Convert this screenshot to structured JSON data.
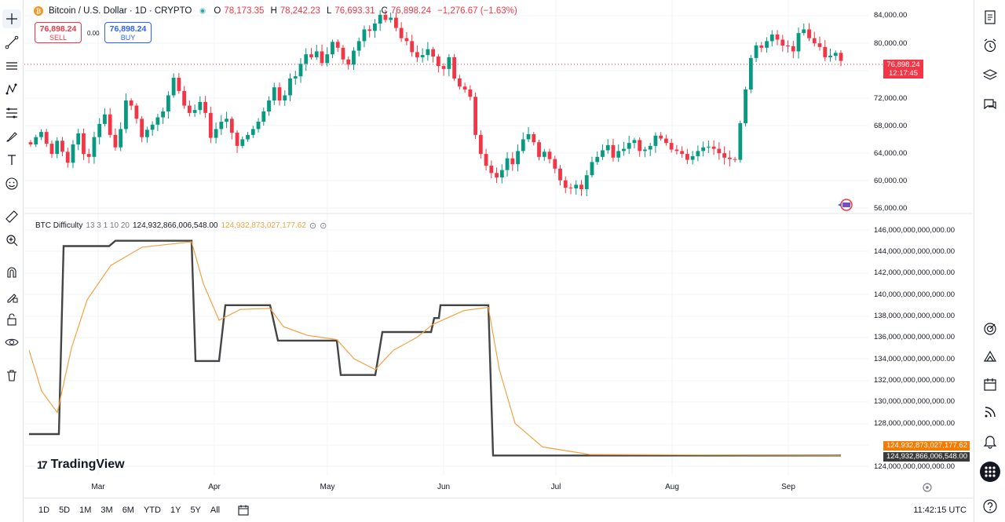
{
  "legend": {
    "symbol_name": "Bitcoin / U.S. Dollar · 1D · CRYPTO",
    "open_label": "O",
    "open": "78,173.35",
    "high_label": "H",
    "high": "78,242.23",
    "low_label": "L",
    "low": "76,693.31",
    "close_label": "C",
    "close": "76,898.24",
    "change": "−1,276.67 (−1.63%)"
  },
  "trade": {
    "sell_price": "76,898.24",
    "sell_label": "SELL",
    "spread": "0.00",
    "buy_price": "76,898.24",
    "buy_label": "BUY"
  },
  "price_axis": {
    "labels": [
      "84,000.00",
      "80,000.00",
      "72,000.00",
      "68,000.00",
      "64,000.00",
      "60,000.00",
      "56,000.00"
    ],
    "current_price": "76,898.24",
    "countdown": "12:17:45"
  },
  "indicator": {
    "name": "BTC Difficulty",
    "params": "13 3 1 10 20",
    "value1": "124,932,866,006,548.00",
    "value2": "124,932,873,027,177.62",
    "axis_labels": [
      "146,000,000,000,000.00",
      "144,000,000,000,000.00",
      "142,000,000,000,000.00",
      "140,000,000,000,000.00",
      "138,000,000,000,000.00",
      "136,000,000,000,000.00",
      "134,000,000,000,000.00",
      "132,000,000,000,000.00",
      "130,000,000,000,000.00",
      "128,000,000,000,000.00",
      "124,000,000,000,000.00"
    ],
    "tag_orange": "124,932,873,027,177.62",
    "tag_dark": "124,932,866,006,548.00",
    "line_color": "#444444",
    "smooth_color": "#f5a142"
  },
  "time_axis": {
    "months": [
      "Mar",
      "Apr",
      "May",
      "Jun",
      "Jul",
      "Aug",
      "Sep"
    ]
  },
  "bottom": {
    "ranges": [
      "1D",
      "5D",
      "1M",
      "3M",
      "6M",
      "YTD",
      "1Y",
      "5Y",
      "All"
    ],
    "clock": "11:42:15 UTC"
  },
  "brand": {
    "name": "TradingView"
  },
  "colors": {
    "up": "#089981",
    "down": "#f23645",
    "accent": "#2962ff"
  },
  "chart_data": {
    "type": "candlestick",
    "title": "Bitcoin / U.S. Dollar · 1D · CRYPTO",
    "ylim": [
      55000,
      85000
    ],
    "close_series": [
      65500,
      66500,
      67200,
      65600,
      64200,
      66000,
      64500,
      63000,
      65500,
      67000,
      64200,
      63800,
      66500,
      68300,
      69600,
      66800,
      65100,
      67600,
      71500,
      70800,
      69000,
      66500,
      67500,
      68200,
      69200,
      70000,
      72200,
      74600,
      72800,
      70800,
      69800,
      70200,
      71300,
      69800,
      66400,
      67600,
      68600,
      69000,
      67100,
      65300,
      66200,
      66800,
      67600,
      68600,
      70000,
      71500,
      73300,
      71500,
      72200,
      74500,
      74800,
      76500,
      77800,
      77400,
      78200,
      76600,
      77800,
      79500,
      78700,
      77100,
      76400,
      78300,
      79600,
      81200,
      81000,
      82000,
      83200,
      82500,
      82800,
      81400,
      80000,
      79600,
      78100,
      77400,
      77700,
      78500,
      77500,
      76200,
      75800,
      77400,
      74500,
      73400,
      73000,
      72000,
      66800,
      64200,
      62600,
      61600,
      61000,
      62000,
      63600,
      62800,
      64600,
      66200,
      66900,
      65800,
      63800,
      64500,
      63500,
      62200,
      60600,
      59600,
      59500,
      60000,
      59400,
      61300,
      63100,
      63800,
      64700,
      65400,
      63700,
      64600,
      64900,
      65700,
      66100,
      64600,
      64800,
      65300,
      66700,
      66300,
      65700,
      64800,
      64600,
      64200,
      63400,
      63900,
      64600,
      65100,
      65200,
      64900,
      64300,
      63700,
      63500,
      63400,
      68400,
      73000,
      77300,
      79000,
      78700,
      79600,
      80500,
      79800,
      79000,
      78900,
      78200,
      80700,
      81200,
      80000,
      79300,
      78800,
      77400,
      77600,
      78000,
      76898
    ]
  }
}
